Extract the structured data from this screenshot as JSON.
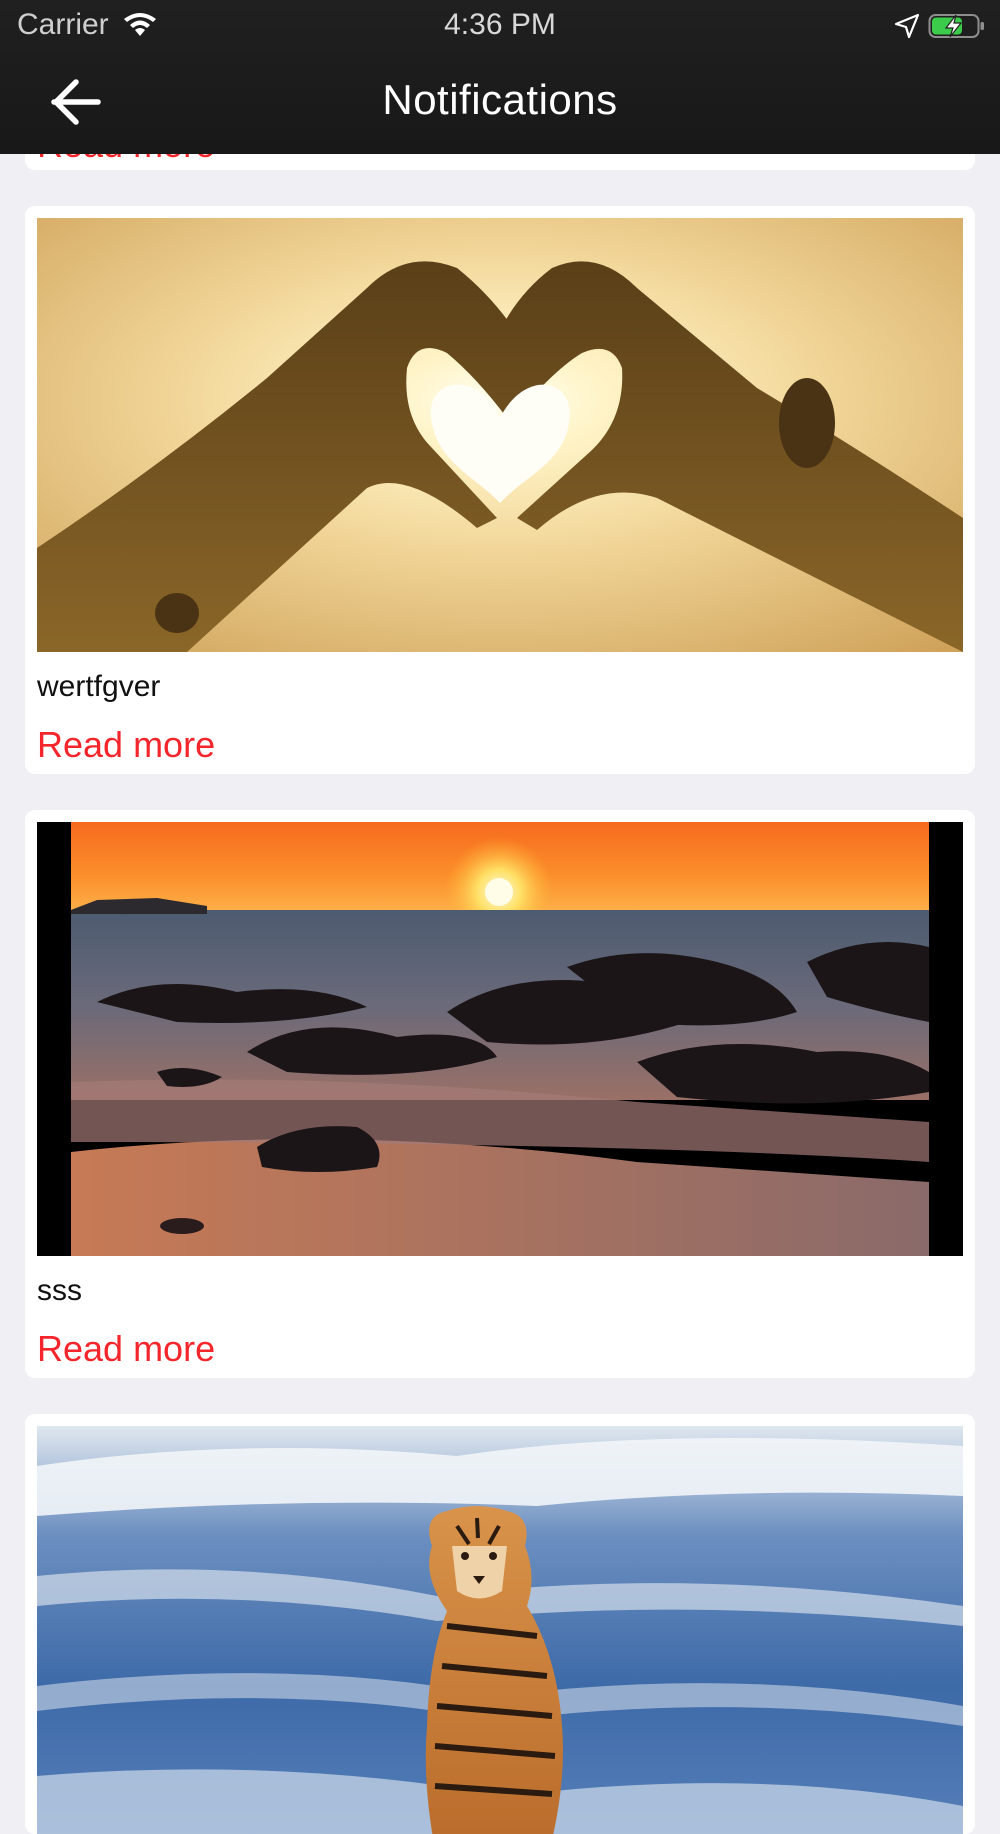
{
  "status_bar": {
    "carrier": "Carrier",
    "time": "4:36 PM",
    "battery_color": "#3ccb4b"
  },
  "nav": {
    "title": "Notifications",
    "back_icon": "arrow-left-icon"
  },
  "theme": {
    "accent": "#f4262c",
    "header_bg": "#1c1c1c",
    "page_bg": "#efeff4"
  },
  "feed": {
    "previous_read_more": "Read more",
    "items": [
      {
        "title": "wertfgver",
        "read_more": "Read more",
        "image": "heart-hands-sunset-photo"
      },
      {
        "title": "sss",
        "read_more": "Read more",
        "image": "beach-sunset-rocks-photo"
      },
      {
        "image": "tiger-snow-photo"
      }
    ]
  }
}
